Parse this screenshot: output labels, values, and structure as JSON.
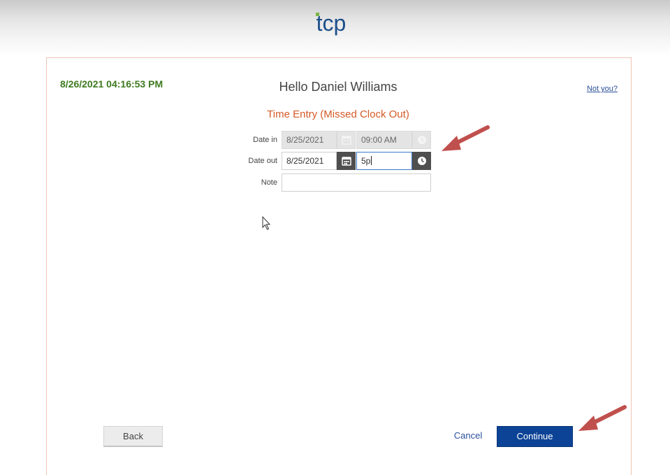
{
  "header": {
    "logo_text": "tcp"
  },
  "session": {
    "datetime": "8/26/2021 04:16:53 PM",
    "greeting": "Hello Daniel Williams",
    "not_you_link": "Not you?"
  },
  "form": {
    "title": "Time Entry (Missed Clock Out)",
    "date_in_label": "Date in",
    "date_in_value": "8/25/2021",
    "time_in_value": "09:00 AM",
    "date_out_label": "Date out",
    "date_out_value": "8/25/2021",
    "time_out_value": "5p",
    "note_label": "Note",
    "note_value": ""
  },
  "footer": {
    "back_label": "Back",
    "cancel_label": "Cancel",
    "continue_label": "Continue"
  },
  "colors": {
    "datetime": "#3d7a1f",
    "title": "#d35a26",
    "link": "#2a4f9c",
    "primary_button": "#0c4396",
    "annotation_arrow": "#c0504d"
  },
  "icons": {
    "date_picker": "calendar-icon",
    "time_picker": "clock-icon",
    "annotation": "arrow-icon",
    "pointer": "mouse-cursor-icon"
  }
}
